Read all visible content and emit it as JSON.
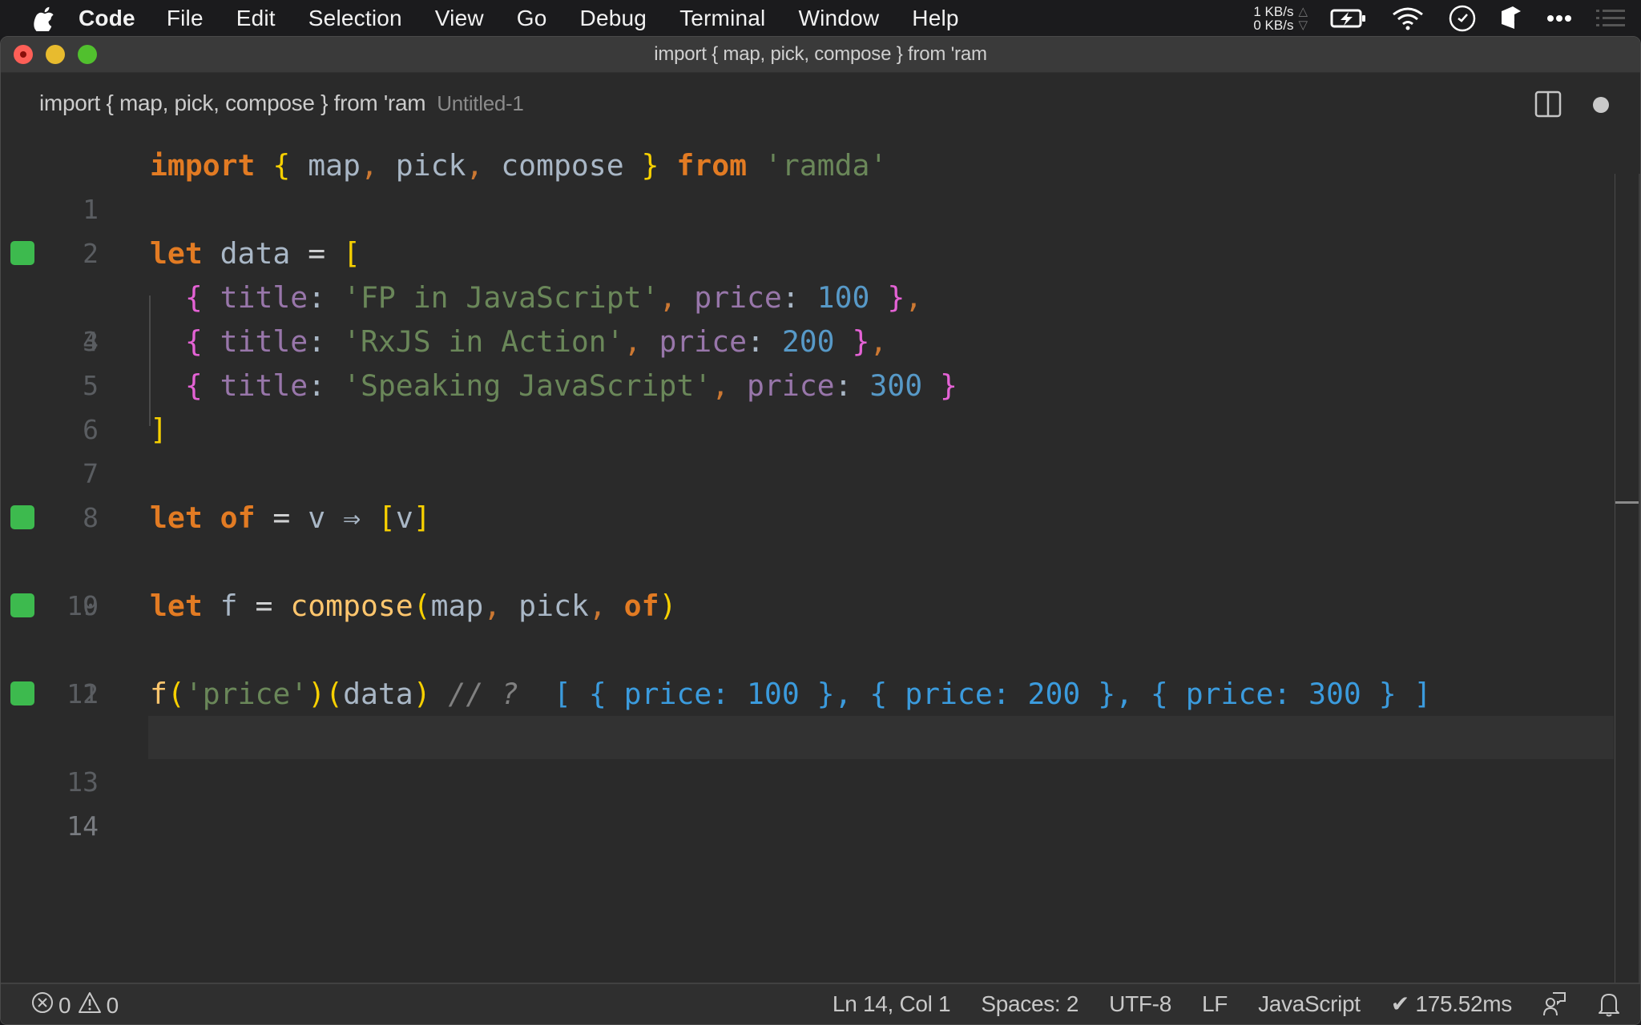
{
  "menubar": {
    "app_name": "Code",
    "items": [
      "File",
      "Edit",
      "Selection",
      "View",
      "Go",
      "Debug",
      "Terminal",
      "Window",
      "Help"
    ],
    "net_up": "1 KB/s",
    "net_down": "0 KB/s",
    "status_icons": [
      "battery-charging-icon",
      "wifi-icon",
      "clock-icon",
      "dropbox-icon",
      "more-icon",
      "notification-center-icon"
    ]
  },
  "window": {
    "title": "import { map, pick, compose } from 'ram"
  },
  "tab": {
    "title": "import { map, pick, compose } from 'ram",
    "description": "Untitled-1",
    "dirty": true
  },
  "editor": {
    "current_line": 14,
    "lines": [
      {
        "n": "1",
        "marker": false
      },
      {
        "n": "2",
        "marker": false
      },
      {
        "n": "3",
        "marker": true
      },
      {
        "n": "4",
        "marker": false
      },
      {
        "n": "5",
        "marker": false
      },
      {
        "n": "6",
        "marker": false
      },
      {
        "n": "7",
        "marker": false
      },
      {
        "n": "8",
        "marker": false
      },
      {
        "n": "9",
        "marker": true
      },
      {
        "n": "10",
        "marker": false
      },
      {
        "n": "11",
        "marker": true
      },
      {
        "n": "12",
        "marker": false
      },
      {
        "n": "13",
        "marker": true
      },
      {
        "n": "14",
        "marker": false
      }
    ],
    "tokens": {
      "l1": [
        "import",
        " ",
        "{",
        " map",
        ",",
        " pick",
        ",",
        " compose ",
        "}",
        " ",
        "from",
        " ",
        "'ramda'"
      ],
      "l3": [
        "let",
        " data ",
        "=",
        " ",
        "["
      ],
      "l4": [
        "  ",
        "{",
        " ",
        "title",
        ":",
        " ",
        "'FP in JavaScript'",
        ",",
        " ",
        "price",
        ":",
        " ",
        "100",
        " ",
        "}",
        ","
      ],
      "l5": [
        "  ",
        "{",
        " ",
        "title",
        ":",
        " ",
        "'RxJS in Action'",
        ",",
        " ",
        "price",
        ":",
        " ",
        "200",
        " ",
        "}",
        ","
      ],
      "l6": [
        "  ",
        "{",
        " ",
        "title",
        ":",
        " ",
        "'Speaking JavaScript'",
        ",",
        " ",
        "price",
        ":",
        " ",
        "300",
        " ",
        "}"
      ],
      "l7": [
        "]"
      ],
      "l9": [
        "let",
        " ",
        "of",
        " ",
        "=",
        " v ",
        "⇒",
        " ",
        "[",
        "v",
        "]"
      ],
      "l11": [
        "let",
        " f ",
        "=",
        " ",
        "compose",
        "(",
        "map",
        ",",
        " pick",
        ",",
        " ",
        "of",
        ")"
      ],
      "l13": [
        "f",
        "(",
        "'price'",
        ")",
        "(",
        "data",
        ")",
        " ",
        "// ?",
        "  ",
        "[ { price: 100 }, { price: 200 }, { price: 300 } ]"
      ]
    }
  },
  "statusbar": {
    "errors": "0",
    "warnings": "0",
    "position": "Ln 14, Col 1",
    "indentation": "Spaces: 2",
    "encoding": "UTF-8",
    "eol": "LF",
    "language": "JavaScript",
    "timing": "✔ 175.52ms"
  },
  "colors": {
    "gutter_marker": "#3dba4e",
    "keyword": "#e27b23",
    "string": "#6a8759",
    "number": "#5799c7",
    "result": "#3b9bdd"
  }
}
